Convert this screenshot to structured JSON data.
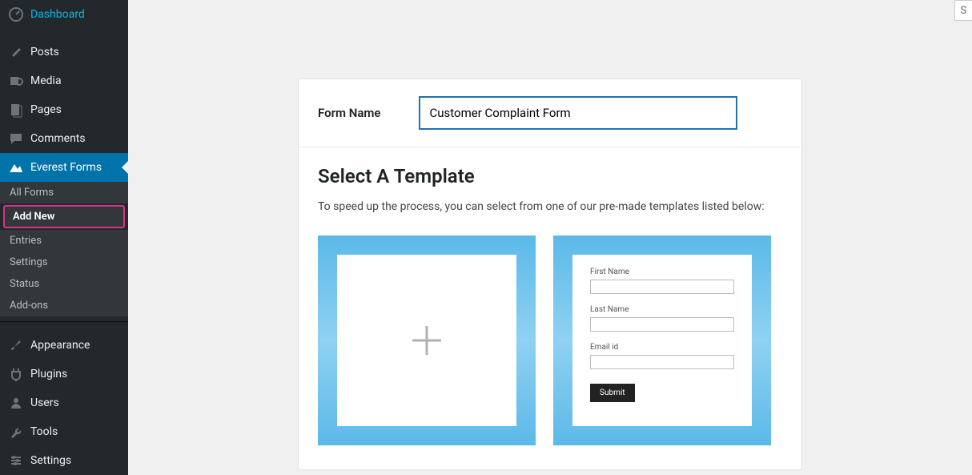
{
  "sidebar": {
    "main": [
      {
        "icon": "dashboard",
        "label": "Dashboard"
      },
      {
        "icon": "pin",
        "label": "Posts"
      },
      {
        "icon": "media",
        "label": "Media"
      },
      {
        "icon": "page",
        "label": "Pages"
      },
      {
        "icon": "comment",
        "label": "Comments"
      }
    ],
    "everest": {
      "label": "Everest Forms",
      "items": [
        "All Forms",
        "Add New",
        "Entries",
        "Settings",
        "Status",
        "Add-ons"
      ],
      "highlighted_index": 1
    },
    "bottom": [
      {
        "icon": "brush",
        "label": "Appearance"
      },
      {
        "icon": "plugin",
        "label": "Plugins"
      },
      {
        "icon": "users",
        "label": "Users"
      },
      {
        "icon": "tools",
        "label": "Tools"
      },
      {
        "icon": "settings",
        "label": "Settings"
      }
    ]
  },
  "top_right_letter": "S",
  "form_name": {
    "label": "Form Name",
    "value": "Customer Complaint Form"
  },
  "templates_section": {
    "heading": "Select A Template",
    "description": "To speed up the process, you can select from one of our pre-made templates listed below:",
    "contact_form": {
      "first_name": "First Name",
      "last_name": "Last Name",
      "email": "Email id",
      "submit": "Submit"
    }
  }
}
